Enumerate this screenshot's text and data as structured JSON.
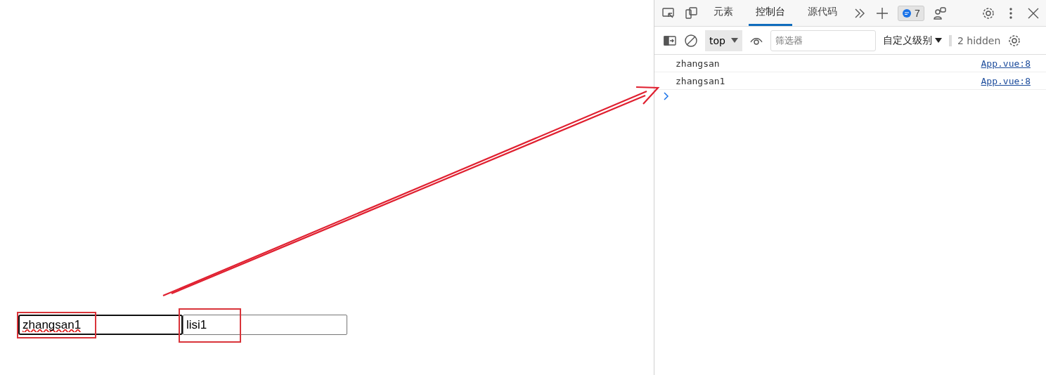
{
  "page": {
    "inputs": [
      {
        "value": "zhangsan1",
        "focused": true
      },
      {
        "value": "lisi1",
        "focused": false
      }
    ]
  },
  "devtools": {
    "tabs": [
      {
        "label": "元素",
        "selected": false
      },
      {
        "label": "控制台",
        "selected": true
      },
      {
        "label": "源代码",
        "selected": false
      }
    ],
    "message_count": "7",
    "context": "top",
    "filter": {
      "placeholder": "筛选器"
    },
    "levels": "自定义级别",
    "hidden": "2 hidden",
    "messages": [
      {
        "text": "zhangsan",
        "source": "App.vue:8"
      },
      {
        "text": "zhangsan1",
        "source": "App.vue:8"
      }
    ]
  }
}
